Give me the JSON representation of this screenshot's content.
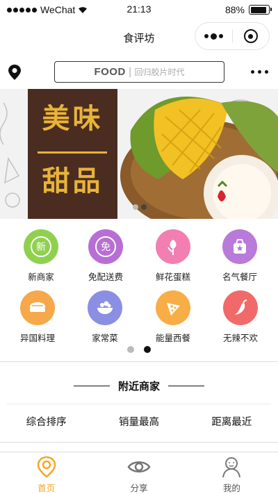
{
  "status_bar": {
    "carrier": "WeChat",
    "time": "21:13",
    "battery": "88%",
    "battery_level": 0.88
  },
  "navbar": {
    "title": "食评坊"
  },
  "search": {
    "brand": "FOOD",
    "separator": "|",
    "slogan": "回归胶片时代"
  },
  "banner": {
    "title_line1": "美味",
    "title_line2": "甜品",
    "active_dot": 1,
    "dot_count": 2
  },
  "categories": [
    {
      "label": "新商家",
      "icon_text": "新",
      "icon": "new-shop-icon",
      "color": "#8fd14f"
    },
    {
      "label": "免配送费",
      "icon_text": "免",
      "icon": "free-delivery-icon",
      "color": "#b86fd4"
    },
    {
      "label": "鲜花蛋糕",
      "icon_text": "",
      "icon": "flower-cake-icon",
      "color": "#f27eb2"
    },
    {
      "label": "名气餐厅",
      "icon_text": "",
      "icon": "famous-restaurant-icon",
      "color": "#b97ad9"
    },
    {
      "label": "异国料理",
      "icon_text": "",
      "icon": "foreign-cuisine-icon",
      "color": "#f6a84b"
    },
    {
      "label": "家常菜",
      "icon_text": "",
      "icon": "home-cooking-icon",
      "color": "#8b8fe3"
    },
    {
      "label": "能量西餐",
      "icon_text": "",
      "icon": "western-food-icon",
      "color": "#f9ad46"
    },
    {
      "label": "无辣不欢",
      "icon_text": "",
      "icon": "spicy-food-icon",
      "color": "#f06a6a"
    }
  ],
  "pager": {
    "count": 2,
    "active": 1,
    "active_color": "#111111",
    "inactive_color": "#bbbbbb"
  },
  "nearby": {
    "title": "附近商家"
  },
  "sort_options": [
    "综合排序",
    "销量最高",
    "距离最近"
  ],
  "tabs": [
    {
      "label": "首页",
      "icon": "home-location-icon",
      "active": true
    },
    {
      "label": "分享",
      "icon": "eye-icon",
      "active": false
    },
    {
      "label": "我的",
      "icon": "user-icon",
      "active": false
    }
  ],
  "colors": {
    "accent": "#f5a623",
    "tab_inactive": "#777777"
  }
}
